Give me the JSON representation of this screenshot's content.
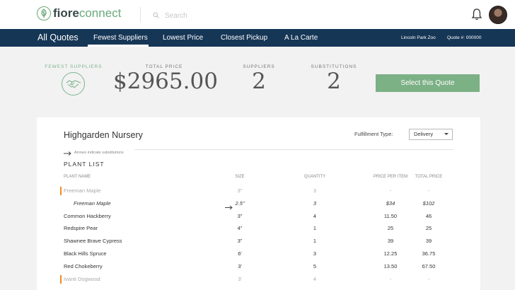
{
  "header": {
    "logo_fiore": "fiore",
    "logo_connect": "connect",
    "search_placeholder": "Search",
    "icons": [
      "leaf-logo-icon",
      "search-icon",
      "bell-icon",
      "user-avatar"
    ]
  },
  "nav": {
    "title": "All Quotes",
    "tabs": [
      {
        "label": "Fewest Suppliers",
        "active": true
      },
      {
        "label": "Lowest Price",
        "active": false
      },
      {
        "label": "Closest Pickup",
        "active": false
      },
      {
        "label": "A La Carte",
        "active": false
      }
    ],
    "location": "Lincoln Park Zoo",
    "quote_number": "Quote #: 000000"
  },
  "summary": {
    "strategy_label": "FEWEST SUPPLIERS",
    "total_label": "TOTAL PRICE",
    "total_value": "$2965.00",
    "suppliers_label": "SUPPLIERS",
    "suppliers_value": "2",
    "substitutions_label": "SUBSTITUTIONS",
    "substitutions_value": "2",
    "select_button": "Select this Quote",
    "accent_color": "#7cb085",
    "nav_color": "#163656",
    "substitution_marker_color": "#f08a24"
  },
  "supplier": {
    "name": "Highgarden Nursery",
    "fulfillment_label": "Fulfillment Type:",
    "fulfillment_value": "Delivery",
    "legend_text": "Arrows indicate substitutions",
    "plant_list_heading": "PLANT LIST",
    "columns": {
      "name": "PLANT NAME",
      "size": "SIZE",
      "quantity": "QUANTITY",
      "price_per_item": "PRICE PER ITEM",
      "total_price": "TOTAL PRICE"
    },
    "rows": [
      {
        "kind": "orig",
        "name": "Freeman Maple",
        "size": "3\"",
        "qty": "3",
        "ppi": "-",
        "total": "-"
      },
      {
        "kind": "sub",
        "name": "Freeman Maple",
        "size": "2.5\"",
        "qty": "3",
        "ppi": "$34",
        "total": "$102"
      },
      {
        "kind": "normal",
        "name": "Common Hackberry",
        "size": "3\"",
        "qty": "4",
        "ppi": "11.50",
        "total": "46"
      },
      {
        "kind": "normal",
        "name": "Redspire Pear",
        "size": "4\"",
        "qty": "1",
        "ppi": "25",
        "total": "25"
      },
      {
        "kind": "normal",
        "name": "Shawnee Brave Cypress",
        "size": "3\"",
        "qty": "1",
        "ppi": "39",
        "total": "39"
      },
      {
        "kind": "normal",
        "name": "Black Hills Spruce",
        "size": "6'",
        "qty": "3",
        "ppi": "12.25",
        "total": "36.75"
      },
      {
        "kind": "normal",
        "name": "Red Chokeberry",
        "size": "3'",
        "qty": "5",
        "ppi": "13.50",
        "total": "67.50"
      },
      {
        "kind": "orig",
        "name": "Ivanti Dogwood",
        "size": "3'",
        "qty": "4",
        "ppi": "-",
        "total": "-"
      }
    ]
  }
}
